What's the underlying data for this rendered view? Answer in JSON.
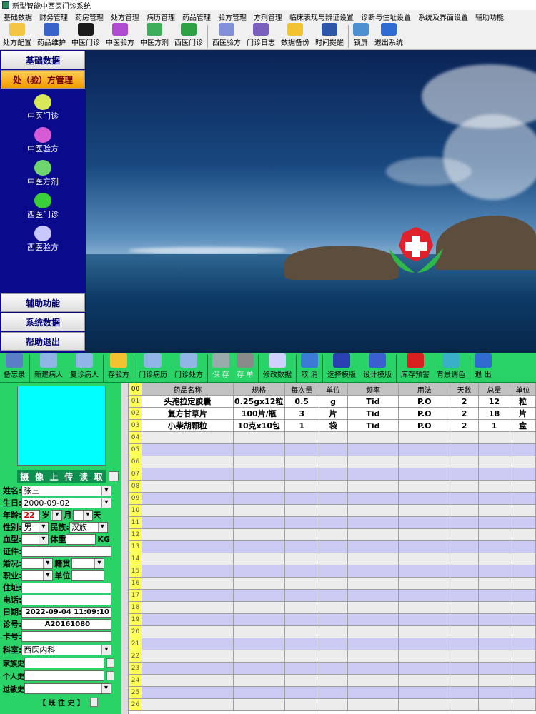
{
  "window": {
    "title": "新型智能中西医门诊系统"
  },
  "menu": [
    "基础数据",
    "财务管理",
    "药房管理",
    "处方管理",
    "病历管理",
    "药品管理",
    "验方管理",
    "方剂管理",
    "临床表现与辨证设置",
    "诊断与住址设置",
    "系统及界面设置",
    "辅助功能"
  ],
  "toolbar": [
    {
      "label": "处方配置",
      "icon": "pen-paper-icon",
      "color": "#f4c542"
    },
    {
      "label": "药品维护",
      "icon": "books-icon",
      "color": "#3a63c9"
    },
    {
      "label": "中医门诊",
      "icon": "yin-yang-icon",
      "color": "#1a1a1a"
    },
    {
      "label": "中医验方",
      "icon": "book-pen-icon",
      "color": "#b04ad0"
    },
    {
      "label": "中医方剂",
      "icon": "book-pen-icon",
      "color": "#3fae5a"
    },
    {
      "label": "西医门诊",
      "icon": "stethoscope-icon",
      "color": "#2ca042"
    },
    {
      "label": "西医验方",
      "icon": "book-pen-icon",
      "color": "#8190d8"
    },
    {
      "label": "门诊日志",
      "icon": "film-icon",
      "color": "#7a5fbe"
    },
    {
      "label": "数据备份",
      "icon": "folder-arrow-icon",
      "color": "#f2c230"
    },
    {
      "label": "时间提醒",
      "icon": "clock-icon",
      "color": "#2d56a8"
    },
    {
      "label": "锁屏",
      "icon": "monitor-icon",
      "color": "#4b8fd0"
    },
    {
      "label": "退出系统",
      "icon": "exit-door-icon",
      "color": "#2f6bd0"
    }
  ],
  "sidebar": {
    "headers_top": [
      "基础数据",
      "处（验）方管理"
    ],
    "items": [
      {
        "label": "中医门诊",
        "icon": "yin-yang-icon",
        "color": "#d7e85a"
      },
      {
        "label": "中医验方",
        "icon": "book-pen-icon",
        "color": "#d65bd6"
      },
      {
        "label": "中医方剂",
        "icon": "book-pen-icon",
        "color": "#6fd66f"
      },
      {
        "label": "西医门诊",
        "icon": "stethoscope-icon",
        "color": "#3ccf3c"
      },
      {
        "label": "西医验方",
        "icon": "book-pen-icon",
        "color": "#c8c8ff"
      }
    ],
    "headers_bottom": [
      "辅助功能",
      "系统数据",
      "帮助退出"
    ]
  },
  "toolbar2": [
    {
      "label": "备忘录",
      "icon": "notepad-icon",
      "color": "#5a7ec8",
      "enabled": true
    },
    {
      "label": "新建病人",
      "icon": "new-document-icon",
      "color": "#8fb4e6",
      "enabled": true
    },
    {
      "label": "复诊病人",
      "icon": "documents-icon",
      "color": "#8fb4e6",
      "enabled": true
    },
    {
      "label": "存验方",
      "icon": "folder-save-icon",
      "color": "#f2c230",
      "enabled": true
    },
    {
      "label": "门诊病历",
      "icon": "record-pen-icon",
      "color": "#8fb4e6",
      "enabled": true
    },
    {
      "label": "门诊处方",
      "icon": "prescription-pen-icon",
      "color": "#8fb4e6",
      "enabled": true
    },
    {
      "label": "保 存",
      "icon": "save-icon",
      "color": "#9aa",
      "enabled": false
    },
    {
      "label": "存 单",
      "icon": "save-list-icon",
      "color": "#8a8a8a",
      "enabled": false
    },
    {
      "label": "修改数据",
      "icon": "eraser-icon",
      "color": "#d0d0ff",
      "enabled": true
    },
    {
      "label": "取 消",
      "icon": "cancel-icon",
      "color": "#3c7ad8",
      "enabled": true
    },
    {
      "label": "选择模版",
      "icon": "template-book-icon",
      "color": "#2a3fb0",
      "enabled": true
    },
    {
      "label": "设计模版",
      "icon": "computer-design-icon",
      "color": "#3b5ed0",
      "enabled": true
    },
    {
      "label": "库存预警",
      "icon": "stop-hand-icon",
      "color": "#d82020",
      "enabled": true
    },
    {
      "label": "背景调色",
      "icon": "palette-icon",
      "color": "#3ab0c8",
      "enabled": true
    },
    {
      "label": "退 出",
      "icon": "exit-door-icon",
      "color": "#2f6bd0",
      "enabled": true
    }
  ],
  "patient": {
    "upload_label": [
      "摄",
      "像",
      "上",
      "传",
      "读",
      "取"
    ],
    "name_label": "姓名:",
    "name": "张三",
    "birth_label": "生日:",
    "birth": "2000-09-02",
    "age_label": "年龄:",
    "age": "22",
    "age_unit1": "岁",
    "age_unit2": "月",
    "age_unit3": "天",
    "gender_label": "性别:",
    "gender": "男",
    "ethnic_label": "民族:",
    "ethnic": "汉族",
    "blood_label": "血型:",
    "weight_label": "体重",
    "weight_unit": "KG",
    "id_label": "证件:",
    "marital_label": "婚况:",
    "native_label": "籍贯",
    "job_label": "职业:",
    "unit_label": "单位",
    "address_label": "住址:",
    "phone_label": "电话:",
    "date_label": "日期:",
    "date": "2022-09-04 11:09:10",
    "visit_label": "诊号:",
    "visit": "A20161080",
    "card_label": "卡号:",
    "dept_label": "科室:",
    "dept": "西医内科",
    "family_label": "家族史",
    "personal_label": "个人史",
    "allergy_label": "过敏史",
    "history_label": "【 既 往 史 】"
  },
  "grid": {
    "corner": "00",
    "columns": [
      "药品名称",
      "规格",
      "每次量",
      "单位",
      "频率",
      "用法",
      "天数",
      "总量",
      "单位"
    ],
    "rows": [
      [
        "头孢拉定胶囊",
        "0.25gx12粒",
        "0.5",
        "g",
        "Tid",
        "P.O",
        "2",
        "12",
        "粒"
      ],
      [
        "复方甘草片",
        "100片/瓶",
        "3",
        "片",
        "Tid",
        "P.O",
        "2",
        "18",
        "片"
      ],
      [
        "小柴胡颗粒",
        "10克x10包",
        "1",
        "袋",
        "Tid",
        "P.O",
        "2",
        "1",
        "盒"
      ]
    ],
    "row_numbers": [
      "01",
      "02",
      "03",
      "04",
      "05",
      "06",
      "07",
      "08",
      "09",
      "10",
      "11",
      "12",
      "13",
      "14",
      "15",
      "16",
      "17",
      "18",
      "19",
      "20",
      "21",
      "22",
      "23",
      "24",
      "25",
      "26"
    ]
  }
}
